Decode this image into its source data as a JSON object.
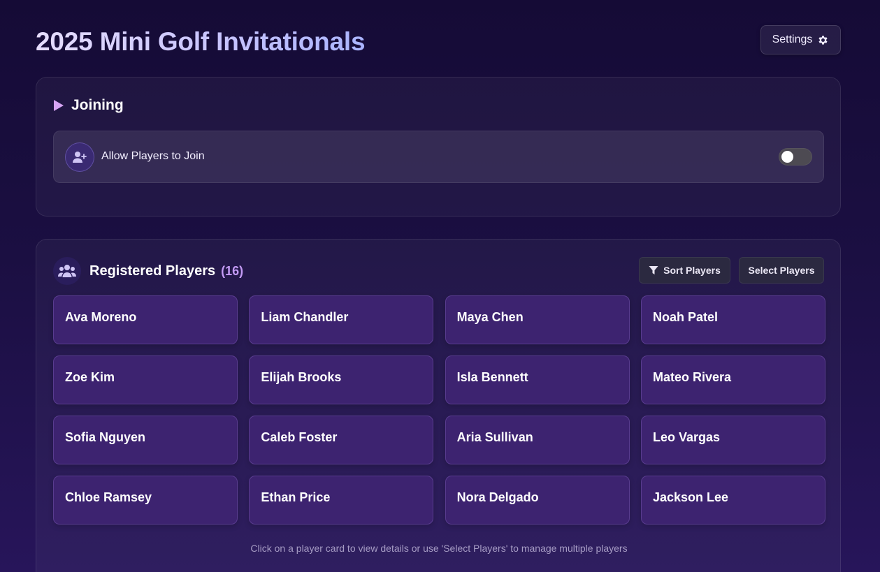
{
  "header": {
    "title": "2025 Mini Golf Invitationals",
    "settings_label": "Settings"
  },
  "joining": {
    "section_title": "Joining",
    "allow_label": "Allow Players to Join",
    "allow_enabled": false
  },
  "players": {
    "section_title": "Registered Players",
    "count": "(16)",
    "sort_label": "Sort Players",
    "select_label": "Select Players",
    "list": [
      "Ava Moreno",
      "Liam Chandler",
      "Maya Chen",
      "Noah Patel",
      "Zoe Kim",
      "Elijah Brooks",
      "Isla Bennett",
      "Mateo Rivera",
      "Sofia Nguyen",
      "Caleb Foster",
      "Aria Sullivan",
      "Leo Vargas",
      "Chloe Ramsey",
      "Ethan Price",
      "Nora Delgado",
      "Jackson Lee"
    ],
    "hint": "Click on a player card to view details or use 'Select Players' to manage multiple players"
  },
  "icons": {
    "settings": "gear-icon",
    "joining": "play-icon",
    "allow": "user-plus-icon",
    "players": "users-icon",
    "sort": "filter-icon"
  },
  "colors": {
    "accent": "#c39af5",
    "card_bg": "#3d2370",
    "page_bg": "#1b0f42"
  }
}
